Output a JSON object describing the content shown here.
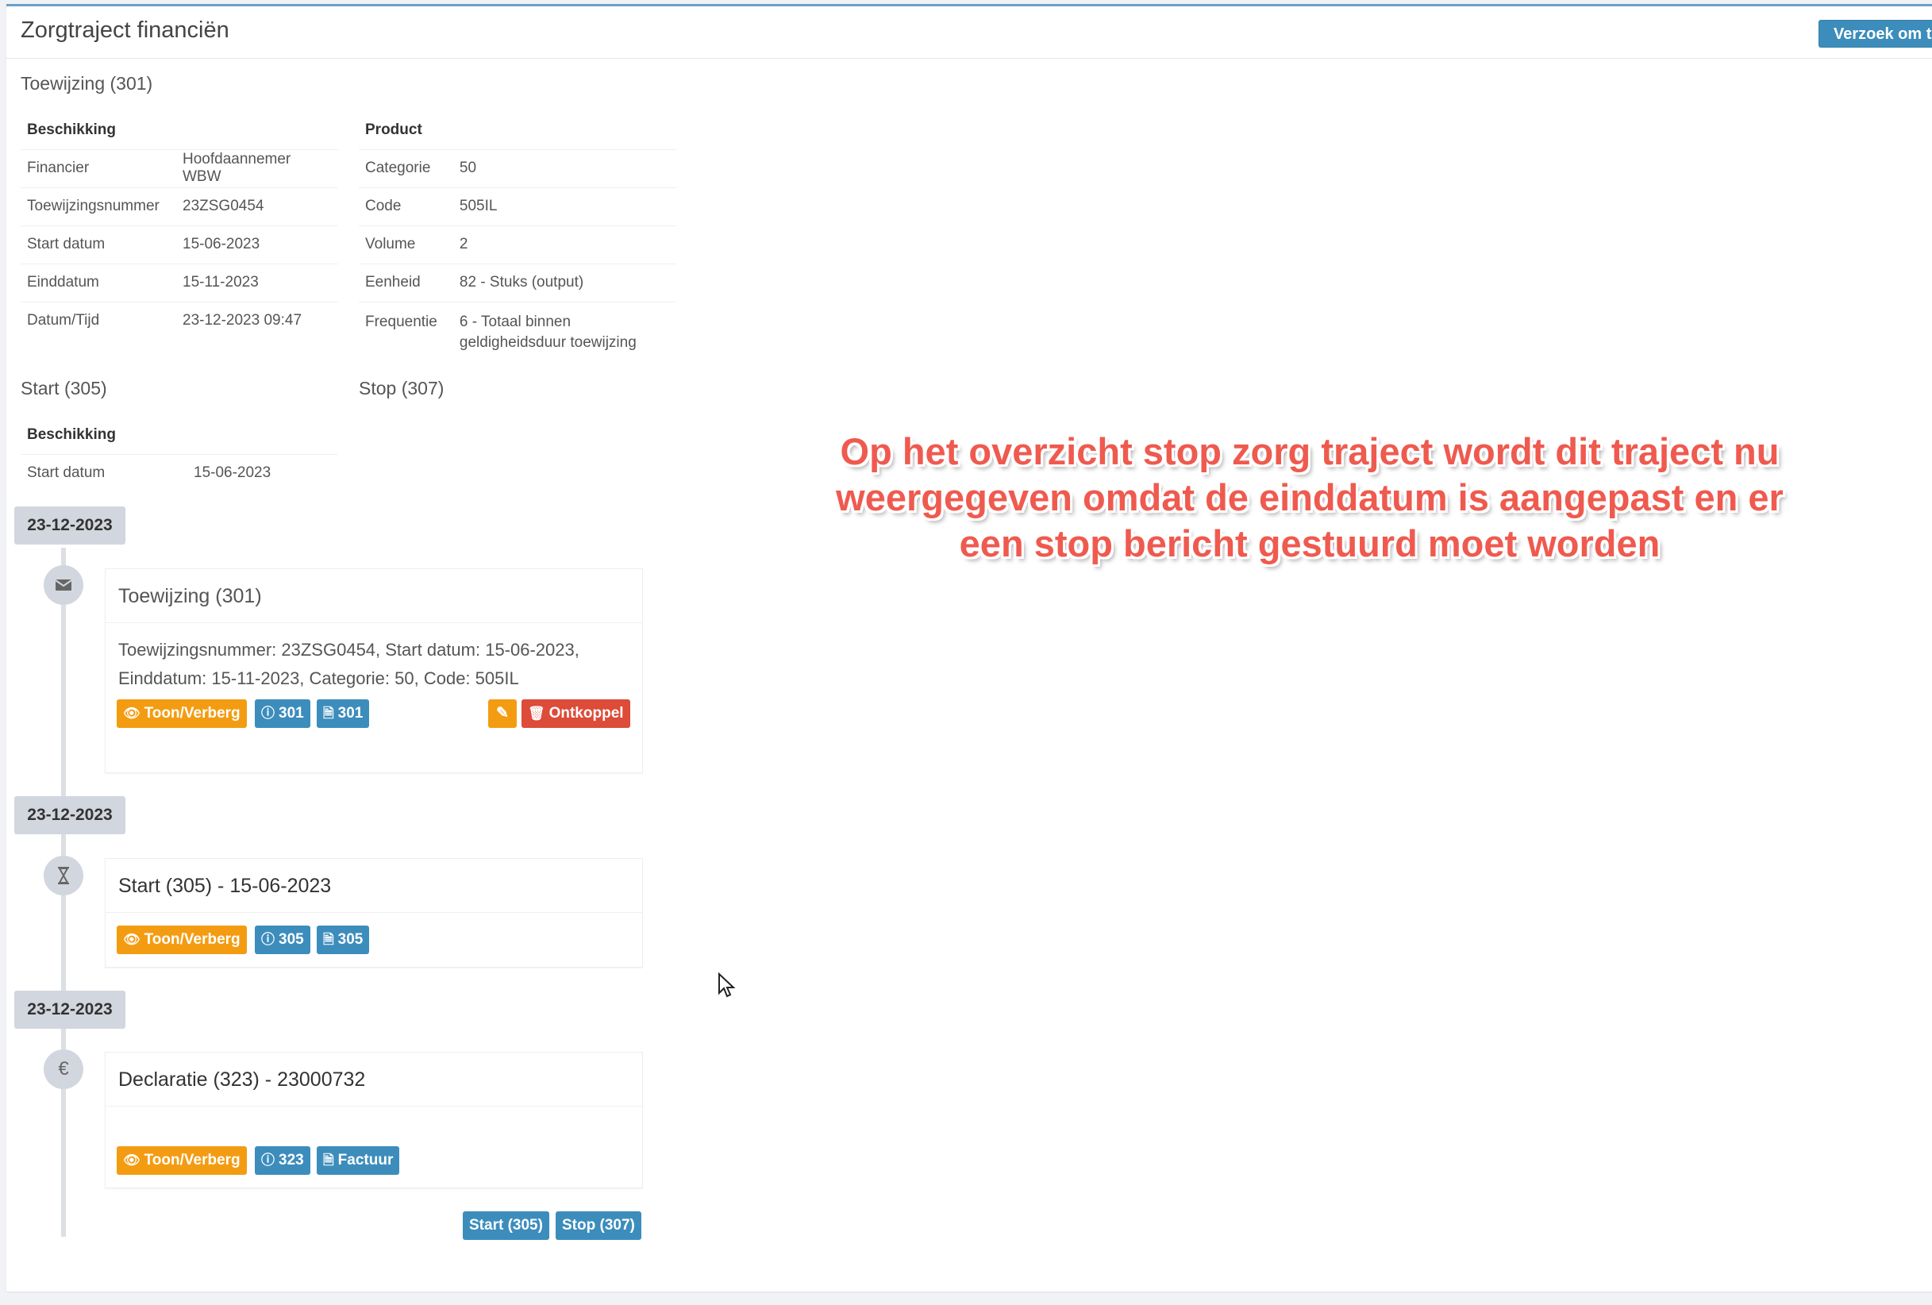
{
  "panel": {
    "title": "Zorgtraject financiën",
    "request_button": "Verzoek om to"
  },
  "toewijzing": {
    "title": "Toewijzing (301)",
    "beschikking": {
      "heading": "Beschikking",
      "rows": [
        {
          "label": "Financier",
          "value": "Hoofdaannemer WBW"
        },
        {
          "label": "Toewijzingsnummer",
          "value": "23ZSG0454"
        },
        {
          "label": "Start datum",
          "value": "15-06-2023"
        },
        {
          "label": "Einddatum",
          "value": "15-11-2023"
        },
        {
          "label": "Datum/Tijd",
          "value": "23-12-2023 09:47"
        }
      ]
    },
    "product": {
      "heading": "Product",
      "rows": [
        {
          "label": "Categorie",
          "value": "50"
        },
        {
          "label": "Code",
          "value": "505IL"
        },
        {
          "label": "Volume",
          "value": "2"
        },
        {
          "label": "Eenheid",
          "value": "82 - Stuks (output)"
        },
        {
          "label": "Frequentie",
          "value": "6 - Totaal binnen geldigheidsduur toewijzing"
        }
      ]
    }
  },
  "start": {
    "title": "Start (305)",
    "beschikking": {
      "heading": "Beschikking",
      "rows": [
        {
          "label": "Start datum",
          "value": "15-06-2023"
        }
      ]
    }
  },
  "stop": {
    "title": "Stop (307)"
  },
  "timeline": [
    {
      "date": "23-12-2023",
      "icon": "envelope-icon",
      "header": "Toewijzing (301)",
      "body": "Toewijzingsnummer: 23ZSG0454, Start datum: 15-06-2023, Einddatum: 15-11-2023, Categorie: 50, Code: 505IL",
      "buttons": {
        "toggle": "Toon/Verberg",
        "info": "301",
        "doc": "301",
        "unlink": "Ontkoppel"
      }
    },
    {
      "date": "23-12-2023",
      "icon": "hourglass-icon",
      "header": "Start (305) - 15-06-2023",
      "buttons": {
        "toggle": "Toon/Verberg",
        "info": "305",
        "doc": "305"
      }
    },
    {
      "date": "23-12-2023",
      "icon": "euro-icon",
      "header": "Declaratie (323) - 23000732",
      "buttons": {
        "toggle": "Toon/Verberg",
        "info": "323",
        "doc": "Factuur"
      }
    }
  ],
  "bottom_buttons": {
    "start": "Start (305)",
    "stop": "Stop (307)"
  },
  "annotation": "Op het overzicht stop zorg traject wordt dit traject nu weergegeven omdat de einddatum is aangepast en er een stop bericht gestuurd moet worden",
  "colors": {
    "primary": "#3c8dbc",
    "warning": "#f39c12",
    "danger": "#dd4b39",
    "annotation": "#ef5a4f"
  }
}
